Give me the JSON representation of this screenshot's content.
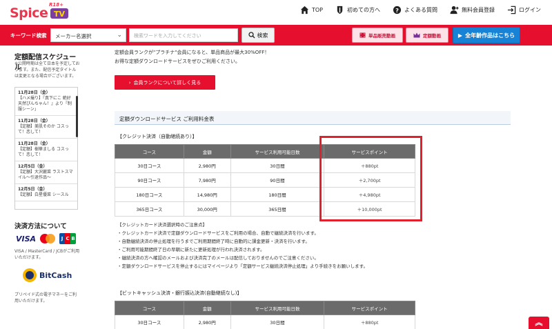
{
  "logo": {
    "text": "Spice",
    "badge": "R18+",
    "tv": "TV"
  },
  "topnav": [
    {
      "label": "TOP",
      "icon": "home-icon"
    },
    {
      "label": "初めての方へ",
      "icon": "shield-icon"
    },
    {
      "label": "よくある質問",
      "icon": "question-icon"
    },
    {
      "label": "無料会員登録",
      "icon": "add-user-icon"
    },
    {
      "label": "ログイン",
      "icon": "login-icon"
    }
  ],
  "searchbar": {
    "keyword_label": "キーワード検索",
    "maker_select": "メーカー名選択",
    "keyword_placeholder": "検索ワードを入力してください",
    "search_button": "検索",
    "single_sale_button": "単品販売動画",
    "subscription_button": "定額動画",
    "all_ages_button": "全年齢作品はこちら"
  },
  "sidebar": {
    "schedule_title": "定額配信スケジュール",
    "schedule_note": "※公開時期は全て日本を予定しております。また、配信予定タイトルは変更となる場合がございます。",
    "schedule": [
      {
        "date": "11月28日（金）",
        "text": "【ハメ撮り】『真下にこ 絶好天然ぴんちゃん！』より「制服シーン」"
      },
      {
        "date": "11月28日（金）",
        "text": "【定額】美肌そのか コスって！恋して！"
      },
      {
        "date": "11月28日（金）",
        "text": "【定額】樹華ましる コスって！恋して！"
      },
      {
        "date": "12月5日（金）",
        "text": "【定額】大沢麗菜 ラストスマイル〜引退作品〜"
      },
      {
        "date": "12月5日（金）",
        "text": "【定額】白星優菜 シースル"
      }
    ],
    "payment_title": "決済方法について",
    "payment_cards": [
      "VISA",
      "MasterCard",
      "JCB"
    ],
    "payment_note_1": "VISA / MasterCard / JCBがご利用いただけます。",
    "bitcash": "BitCash",
    "payment_note_2": "プリペイド式の電子マネーをご利用いただけます。"
  },
  "main": {
    "intro_line1": "定額会員ランクが\"プラチナ\"会員になると、単品商品が最大30%OFF！",
    "intro_line2": "お得な定額ダウンロードサービスをぜひご利用ください。",
    "rank_button": "会員ランクについて詳しく見る",
    "section_title": "定額ダウンロードサービス ご利用料金表",
    "table1_title": "【クレジット決済（自動継続あり）】",
    "table2_title": "【ビットキャッシュ決済・銀行振込決済(自動継続なし)】",
    "columns": [
      "コース",
      "金額",
      "サービス利用可能日数",
      "サービスポイント"
    ],
    "rows1": [
      [
        "30日コース",
        "2,980円",
        "30日間",
        "＋880pt"
      ],
      [
        "90日コース",
        "7,980円",
        "90日間",
        "＋2,700pt"
      ],
      [
        "180日コース",
        "14,980円",
        "180日間",
        "＋4,980pt"
      ],
      [
        "365日コース",
        "30,000円",
        "365日間",
        "＋10,000pt"
      ]
    ],
    "rows2": [
      [
        "30日コース",
        "2,980円",
        "30日間",
        "＋880pt"
      ]
    ],
    "notes": [
      "【クレジットカード決済選択時のご注意点】",
      "・クレジットカード決済で定額ダウンロードサービスをご利用の場合、自動で継続決済を行います。",
      "・自動継続決済の停止処理を行うまでご利用期間終了時に自動的に課金更新・決済を行います。",
      "・ご利用可能期間終了日の早朝に新たに更新処理が行われ決済されます。",
      "・継続決済の方へ確認のメールおよび決済完了のメールは配信しておりませんのでご注意ください。",
      "・定額ダウンロードサービスを停止するにはマイページより「定額サービス継続決済停止処理」より手続きをお願いします。"
    ]
  },
  "scroll_top_label": "︽",
  "colors": {
    "brand_red": "#e60f2d",
    "highlight_box": "#e0202a",
    "blue": "#1683d6"
  }
}
